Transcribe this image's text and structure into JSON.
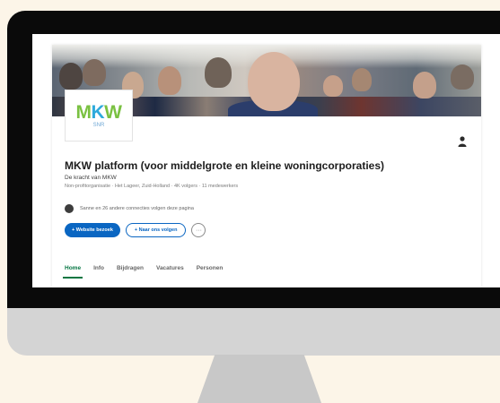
{
  "company": {
    "logo": {
      "letters": [
        "M",
        "K",
        "W"
      ],
      "letter_colors": [
        "#7ac142",
        "#2eaadc",
        "#7ac142"
      ],
      "sub": "SNR"
    },
    "title": "MKW platform (voor middelgrote en kleine woningcorporaties)",
    "tagline": "De kracht van MKW",
    "meta": "Non-profitorganisatie · Het Lageer, Zuid-Holland · 4K volgers · 11 medewerkers",
    "connections_text": "Sanne en 26 andere connecties volgen deze pagina"
  },
  "actions": {
    "follow_label": "+ Website bezoek",
    "visit_label": "+ Naar ons volgen",
    "more_label": "···"
  },
  "tabs": [
    {
      "label": "Home",
      "active": true
    },
    {
      "label": "Info",
      "active": false
    },
    {
      "label": "Bijdragen",
      "active": false
    },
    {
      "label": "Vacatures",
      "active": false
    },
    {
      "label": "Personen",
      "active": false
    }
  ],
  "colors": {
    "primary": "#0a66c2",
    "active_tab": "#057642",
    "frame": "#0a0a0a",
    "stand": "#c8c8c8",
    "background": "#fcf5e8"
  }
}
